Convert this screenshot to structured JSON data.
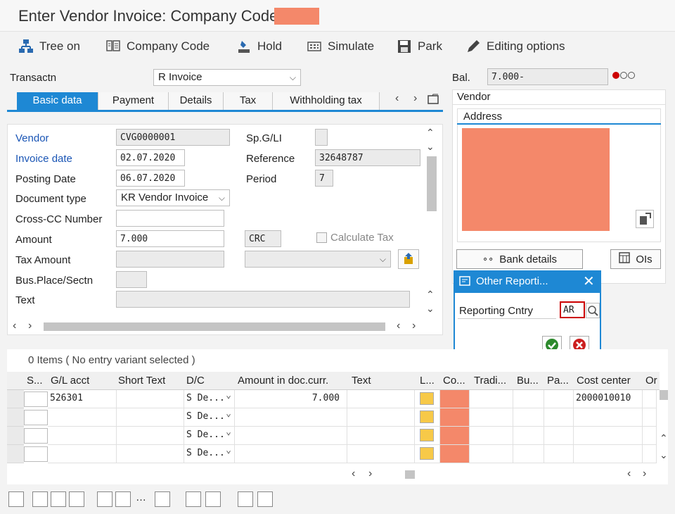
{
  "window": {
    "title": "Enter Vendor Invoice: Company Code"
  },
  "toolbar": {
    "tree_on": "Tree on",
    "company_code": "Company Code",
    "hold": "Hold",
    "simulate": "Simulate",
    "park": "Park",
    "editing_options": "Editing options"
  },
  "header": {
    "transactn_label": "Transactn",
    "transactn_value": "R Invoice",
    "bal_label": "Bal.",
    "bal_value": "7.000-"
  },
  "tabs": [
    "Basic data",
    "Payment",
    "Details",
    "Tax",
    "Withholding tax"
  ],
  "form": {
    "vendor_label": "Vendor",
    "vendor_value": "CVG0000001",
    "invoice_date_label": "Invoice date",
    "invoice_date_value": "02.07.2020",
    "posting_date_label": "Posting Date",
    "posting_date_value": "06.07.2020",
    "doc_type_label": "Document type",
    "doc_type_value": "KR Vendor Invoice",
    "cross_cc_label": "Cross-CC Number",
    "amount_label": "Amount",
    "amount_value": "7.000",
    "currency_value": "CRC",
    "calc_tax_label": "Calculate Tax",
    "tax_amount_label": "Tax Amount",
    "bus_place_label": "Bus.Place/Sectn",
    "text_label": "Text",
    "spgl_label": "Sp.G/LI",
    "reference_label": "Reference",
    "reference_value": "32648787",
    "period_label": "Period",
    "period_value": "7"
  },
  "vendor_panel": {
    "title": "Vendor",
    "address_title": "Address",
    "bank_details": "Bank details",
    "ois": "OIs"
  },
  "popup": {
    "title": "Other Reporti...",
    "field_label": "Reporting Cntry",
    "field_value": "AR"
  },
  "grid": {
    "items_text": "0 Items ( No entry variant selected )",
    "columns": [
      "S...",
      "G/L acct",
      "Short Text",
      "D/C",
      "Amount in doc.curr.",
      "Text",
      "L...",
      "Co...",
      "Tradi...",
      "Bu...",
      "Pa...",
      "Cost center",
      "Or"
    ],
    "rows": [
      {
        "gl": "526301",
        "dc": "S De...",
        "amount": "7.000",
        "cost_center": "2000010010"
      },
      {
        "gl": "",
        "dc": "S De...",
        "amount": "",
        "cost_center": ""
      },
      {
        "gl": "",
        "dc": "S De...",
        "amount": "",
        "cost_center": ""
      },
      {
        "gl": "",
        "dc": "S De...",
        "amount": "",
        "cost_center": ""
      }
    ]
  },
  "colors": {
    "accent": "#1e88d4",
    "mask": "#f4886a",
    "status_red": "#cc0000"
  }
}
